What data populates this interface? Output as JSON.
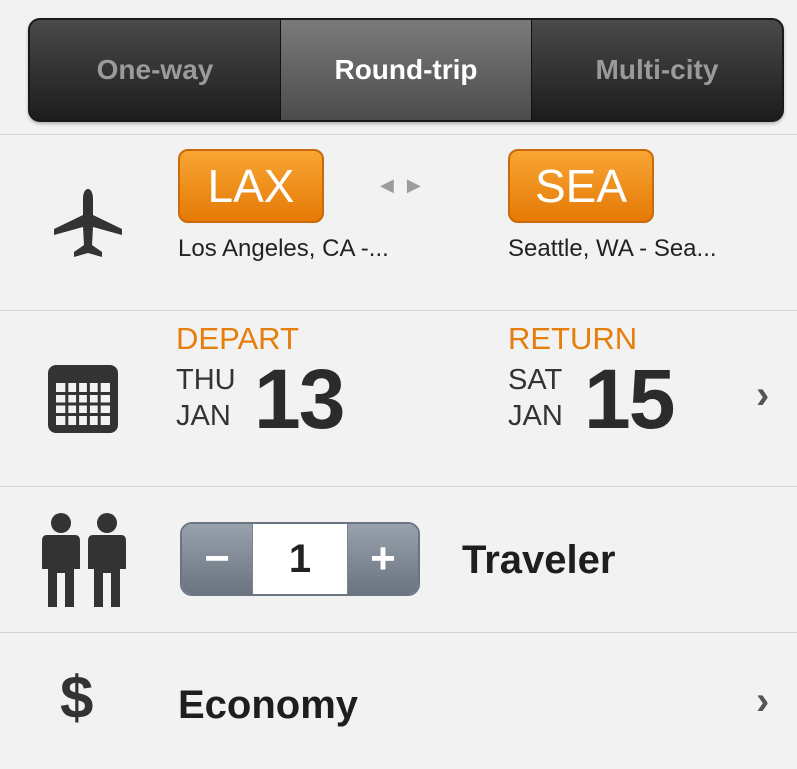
{
  "trip_tabs": [
    {
      "label": "One-way"
    },
    {
      "label": "Round-trip"
    },
    {
      "label": "Multi-city"
    }
  ],
  "route": {
    "origin_code": "LAX",
    "origin_city": "Los Angeles, CA -...",
    "destination_code": "SEA",
    "destination_city": "Seattle, WA - Sea...",
    "swap_glyph": "◀ ▶"
  },
  "dates": {
    "depart_label": "DEPART",
    "depart_weekday": "THU",
    "depart_month": "JAN",
    "depart_day": "13",
    "return_label": "RETURN",
    "return_weekday": "SAT",
    "return_month": "JAN",
    "return_day": "15"
  },
  "travelers": {
    "minus": "−",
    "count": "1",
    "plus": "+",
    "label": "Traveler"
  },
  "cabin": {
    "icon_glyph": "$",
    "label": "Economy"
  },
  "chevron": "›",
  "colors": {
    "accent_orange": "#e67e0c",
    "button_orange": "#f39220",
    "stepper_gray": "#7f8893"
  }
}
